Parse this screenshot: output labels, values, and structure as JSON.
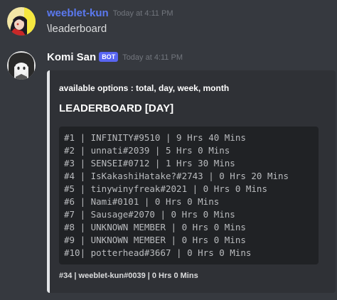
{
  "messages": [
    {
      "author": "weeblet-kun",
      "author_color": "#5b79f0",
      "timestamp": "Today at 4:11 PM",
      "content": "\\leaderboard",
      "avatar_icon": "anime-avatar-icon"
    },
    {
      "author": "Komi San",
      "author_color": "#ffffff",
      "bot_tag": "BOT",
      "timestamp": "Today at 4:11 PM",
      "avatar_icon": "anime-bot-avatar-icon",
      "embed": {
        "description": "available options : total, day, week, month",
        "heading": "LEADERBOARD [DAY]",
        "rows": [
          "#1 | INFINITY#9510 | 9 Hrs 40 Mins",
          "#2 | unnati#2039 | 5 Hrs 0 Mins",
          "#3 | SENSEI#0712 | 1 Hrs 30 Mins",
          "#4 | IsKakashiHatake?#2743 | 0 Hrs 20 Mins",
          "#5 | tinywinyfreak#2021 | 0 Hrs 0 Mins",
          "#6 | Nami#0101 | 0 Hrs 0 Mins",
          "#7 | Sausage#2070 | 0 Hrs 0 Mins",
          "#8 | UNKNOWN MEMBER | 0 Hrs 0 Mins",
          "#9 | UNKNOWN MEMBER | 0 Hrs 0 Mins",
          "#10| potterhead#3667 | 0 Hrs 0 Mins"
        ],
        "footer": "#34 | weeblet-kun#0039 | 0 Hrs 0 Mins"
      }
    }
  ],
  "colors": {
    "background": "#36393f",
    "embed_background": "#2f3136",
    "embed_border": "#e3e5e8",
    "code_background": "#202225",
    "bot_tag": "#5865f2",
    "timestamp": "#72767d"
  }
}
